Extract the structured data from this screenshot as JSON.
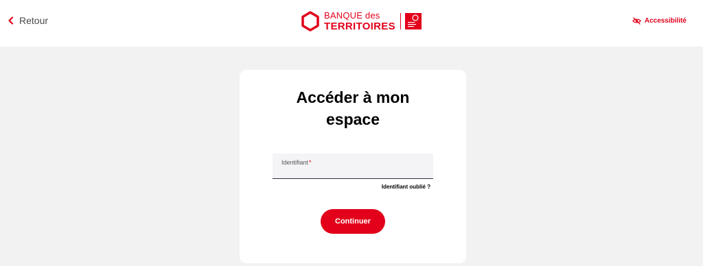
{
  "header": {
    "back_label": "Retour",
    "logo": {
      "line1": "BANQUE des",
      "line2": "TERRITOIRES"
    },
    "accessibility_label": "Accessibilité"
  },
  "login": {
    "title_line1": "Accéder à mon",
    "title_line2": "espace",
    "identifier_label": "Identifiant",
    "required_mark": "*",
    "identifier_value": "",
    "forgot_label": "Identifiant oublié ?",
    "continue_label": "Continuer"
  },
  "colors": {
    "brand_red": "#e2001a",
    "background": "#f2f2f2",
    "card": "#ffffff"
  },
  "icons": {
    "back": "chevron-left-icon",
    "accessibility": "eye-slash-icon",
    "logo": "hexagon-logo-icon"
  }
}
